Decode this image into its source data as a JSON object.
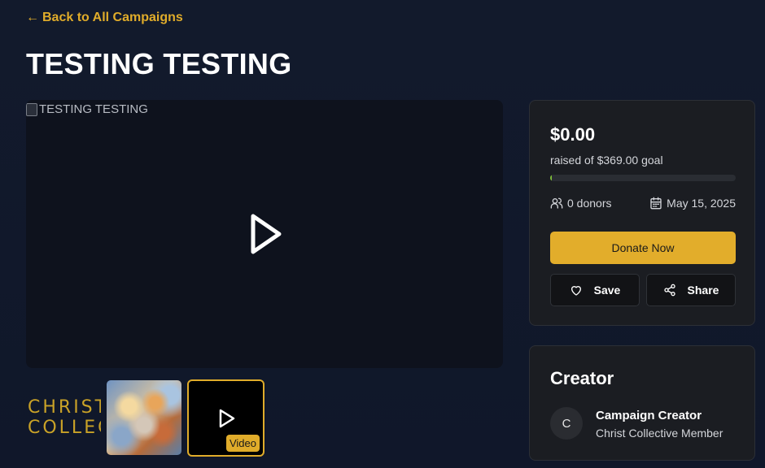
{
  "nav": {
    "back_arrow": "←",
    "back_label": "Back to All Campaigns"
  },
  "campaign": {
    "title": "TESTING TESTING",
    "media_alt": "TESTING TESTING"
  },
  "gallery": {
    "logo_line1": "CHRIST",
    "logo_line2": "COLLECTIVE",
    "video_badge": "Video",
    "thumb_art_alt": "painting-thumbnail"
  },
  "donation": {
    "amount": "$0.00",
    "goal_text": "raised of $369.00 goal",
    "progress_fraction": 0.0,
    "donors": "0 donors",
    "date": "May 15, 2025",
    "donate_label": "Donate Now",
    "save_label": "Save",
    "share_label": "Share"
  },
  "creator": {
    "heading": "Creator",
    "avatar_initial": "C",
    "name": "Campaign Creator",
    "role": "Christ Collective Member"
  },
  "colors": {
    "accent": "#e2ad2b",
    "background": "#121a2c",
    "card": "#1b1d22",
    "progress": "#7dbb3a"
  },
  "icons": {
    "back": "arrow-left-icon",
    "play": "play-icon",
    "donors": "users-icon",
    "date": "calendar-icon",
    "save": "heart-icon",
    "share": "share-icon"
  }
}
